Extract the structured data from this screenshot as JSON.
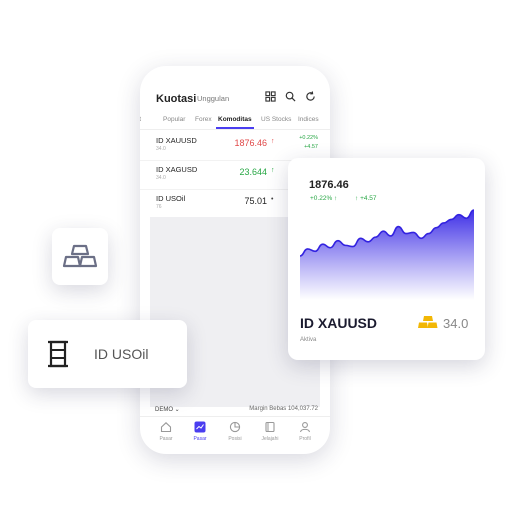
{
  "app": {
    "title": "Kuotasi",
    "subtitle": "Unggulan"
  },
  "tabs": [
    {
      "label": "st"
    },
    {
      "label": "Popular"
    },
    {
      "label": "Forex"
    },
    {
      "label": "Komoditas",
      "active": true
    },
    {
      "label": "US Stocks"
    },
    {
      "label": "Indices"
    }
  ],
  "quotes": [
    {
      "symbol": "ID XAUUSD",
      "sub": "34.0",
      "price": "1876.46",
      "arrow": "↑",
      "price_color": "#e04848",
      "change_pct": "+0.22%",
      "change_abs": "+4.57"
    },
    {
      "symbol": "ID XAGUSD",
      "sub": "34.0",
      "price": "23.644",
      "arrow": "↑",
      "price_color": "#28a745",
      "change_pct": "",
      "change_abs": ""
    },
    {
      "symbol": "ID USOil",
      "sub": "76",
      "price": "75.01",
      "arrow": "•",
      "price_color": "#222222",
      "change_pct": "",
      "change_abs": ""
    }
  ],
  "status": {
    "account": "DEMO",
    "chevron": "⌄",
    "margin": "Margin Bebas 104,037.72"
  },
  "nav": [
    {
      "label": "Pasar",
      "icon": "home-icon"
    },
    {
      "label": "Pasar",
      "icon": "chart-icon",
      "active": true
    },
    {
      "label": "Posisi",
      "icon": "pie-icon"
    },
    {
      "label": "Jelajahi",
      "icon": "book-icon"
    },
    {
      "label": "Profil",
      "icon": "user-icon"
    }
  ],
  "chart_card": {
    "price": "1876.46",
    "change_pct": "+0.22%",
    "change_abs": "+4.57",
    "symbol": "ID XAUUSD",
    "sub": "Aktiva",
    "value": "34.0",
    "gold_icon": "gold-bars-icon"
  },
  "oil_card": {
    "label": "ID USOil",
    "icon": "barrel-icon"
  },
  "gold_card": {
    "icon": "gold-bars-outline-icon"
  },
  "colors": {
    "accent": "#4a3df0",
    "up": "#28a745",
    "down": "#e04848",
    "gold": "#f2b705"
  },
  "sparkline": [
    10,
    22,
    18,
    30,
    24,
    36,
    28,
    26,
    40,
    34,
    42,
    52,
    44,
    60,
    48,
    50,
    40,
    48,
    58,
    66,
    72,
    80,
    74,
    88
  ]
}
